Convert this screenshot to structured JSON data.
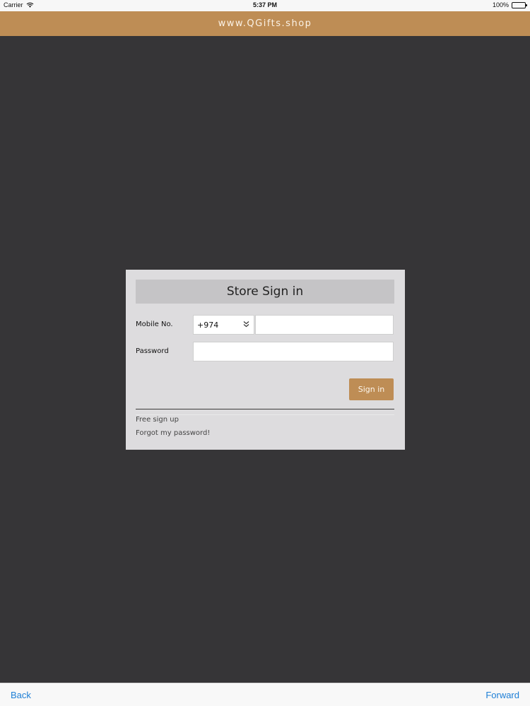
{
  "status_bar": {
    "carrier": "Carrier",
    "time": "5:37 PM",
    "battery": "100%",
    "wifi_icon": "wifi-icon",
    "battery_icon": "battery-icon"
  },
  "header": {
    "title": "www.QGifts.shop",
    "background": "#be8d55"
  },
  "signin": {
    "title": "Store Sign in",
    "mobile_label": "Mobile No.",
    "country_code": "+974",
    "country_chevron_icon": "double-chevron-down-icon",
    "mobile_value": "",
    "password_label": "Password",
    "password_value": "",
    "submit_label": "Sign in",
    "free_signup_link": "Free sign up",
    "forgot_password_link": "Forgot my password!"
  },
  "toolbar": {
    "back_label": "Back",
    "forward_label": "Forward",
    "link_color": "#1e7fd6"
  }
}
